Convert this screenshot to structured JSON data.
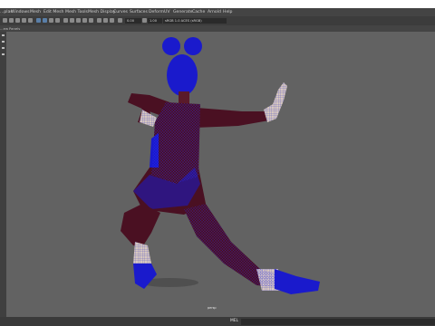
{
  "menu": {
    "items": [
      "...plas",
      "Windows",
      "Mesh",
      "Edit Mesh",
      "Mesh Tools",
      "Mesh Display",
      "Curves",
      "Surfaces",
      "Deform",
      "UV",
      "Generate",
      "Cache",
      "Arnold",
      "Help"
    ]
  },
  "toolbar": {
    "field_a": "0.00",
    "field_b": "1.00",
    "camera_select": "sRGB 1.0 ACES (sRGB)"
  },
  "view_menu": {
    "items": [
      "...ew",
      "Panels"
    ]
  },
  "viewport": {
    "camera_label": "persp",
    "model_color": "#1a1acc",
    "background": "#626262"
  },
  "status": {
    "mel_label": "MEL"
  }
}
